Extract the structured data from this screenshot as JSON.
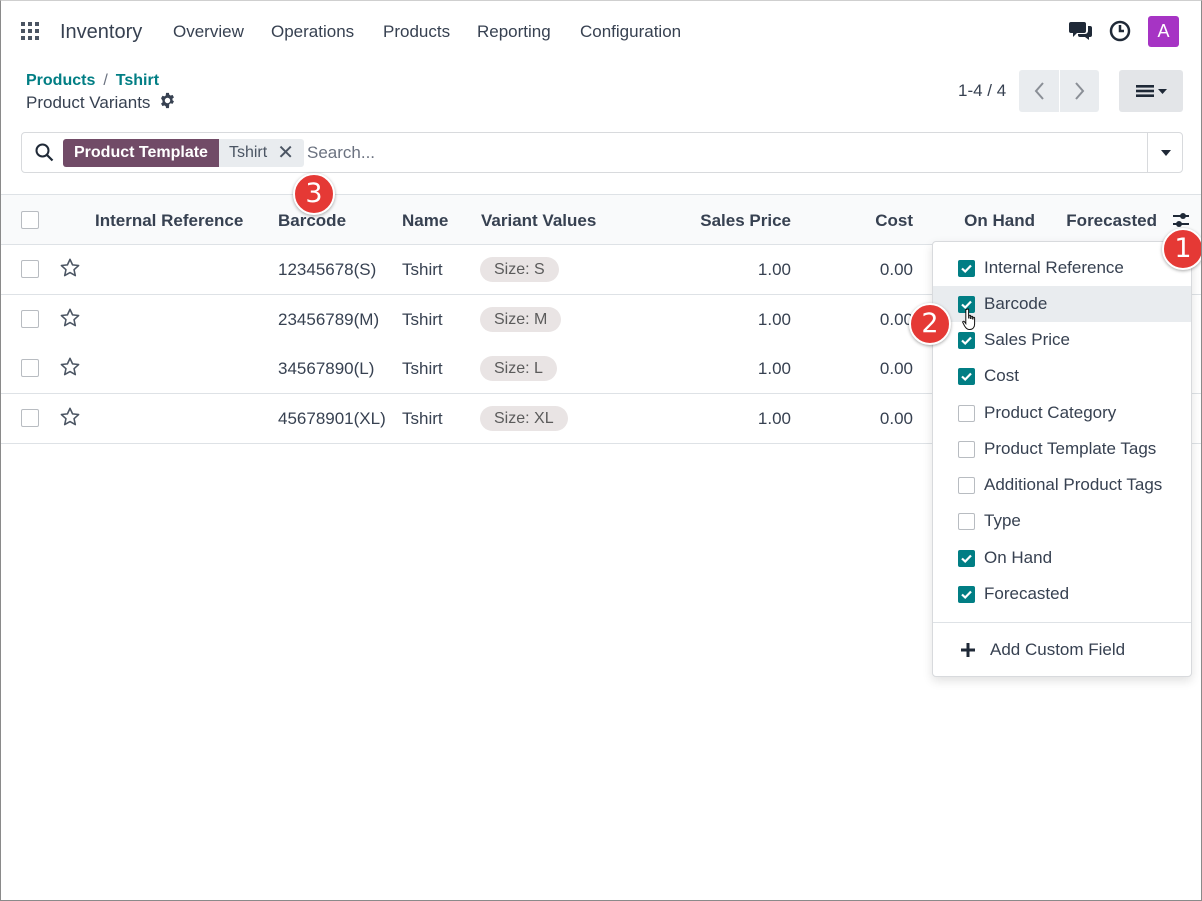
{
  "navbar": {
    "brand": "Inventory",
    "menu": [
      "Overview",
      "Operations",
      "Products",
      "Reporting",
      "Configuration"
    ],
    "avatar_letter": "A"
  },
  "breadcrumb": {
    "parent": "Products",
    "separator": "/",
    "current": "Tshirt"
  },
  "page_title": "Product Variants",
  "pager": {
    "range": "1-4 / 4"
  },
  "search": {
    "facet_label": "Product Template",
    "facet_value": "Tshirt",
    "placeholder": "Search..."
  },
  "table": {
    "headers": {
      "internal_reference": "Internal Reference",
      "barcode": "Barcode",
      "name": "Name",
      "variant_values": "Variant Values",
      "sales_price": "Sales Price",
      "cost": "Cost",
      "on_hand": "On Hand",
      "forecasted": "Forecasted"
    },
    "rows": [
      {
        "barcode": "12345678(S)",
        "name": "Tshirt",
        "variant": "Size: S",
        "sales_price": "1.00",
        "cost": "0.00"
      },
      {
        "barcode": "23456789(M)",
        "name": "Tshirt",
        "variant": "Size: M",
        "sales_price": "1.00",
        "cost": "0.00"
      },
      {
        "barcode": "34567890(L)",
        "name": "Tshirt",
        "variant": "Size: L",
        "sales_price": "1.00",
        "cost": "0.00"
      },
      {
        "barcode": "45678901(XL)",
        "name": "Tshirt",
        "variant": "Size: XL",
        "sales_price": "1.00",
        "cost": "0.00"
      }
    ]
  },
  "optional_columns": {
    "items": [
      {
        "label": "Internal Reference",
        "checked": true
      },
      {
        "label": "Barcode",
        "checked": true
      },
      {
        "label": "Sales Price",
        "checked": true
      },
      {
        "label": "Cost",
        "checked": true
      },
      {
        "label": "Product Category",
        "checked": false
      },
      {
        "label": "Product Template Tags",
        "checked": false
      },
      {
        "label": "Additional Product Tags",
        "checked": false
      },
      {
        "label": "Type",
        "checked": false
      },
      {
        "label": "On Hand",
        "checked": true
      },
      {
        "label": "Forecasted",
        "checked": true
      }
    ],
    "add_custom_field": "Add Custom Field"
  },
  "markers": [
    "1",
    "2",
    "3"
  ],
  "colors": {
    "accent": "#017e84",
    "facet": "#714b67",
    "avatar": "#a634c4",
    "marker": "#e53935"
  }
}
